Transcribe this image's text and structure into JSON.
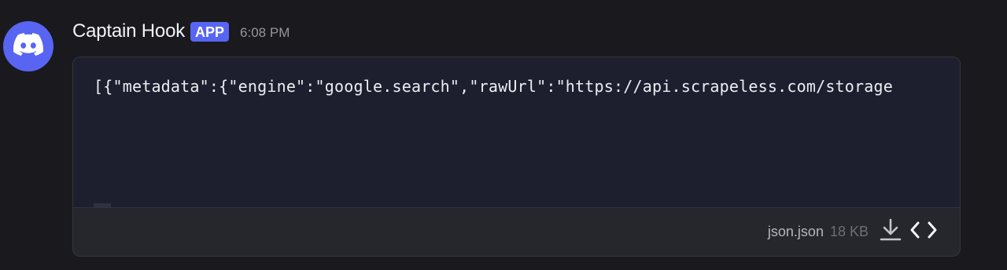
{
  "message": {
    "author": "Captain Hook",
    "badge": "APP",
    "timestamp": "6:08 PM",
    "avatar_icon": "discord-logo-icon"
  },
  "attachment": {
    "preview_text": "[{\"metadata\":{\"engine\":\"google.search\",\"rawUrl\":\"https://api.scrapeless.com/storage",
    "filename": "json.json",
    "filesize": "18 KB",
    "actions": {
      "download_icon": "download-icon",
      "view_code_icon": "code-icon"
    }
  },
  "colors": {
    "background": "#1a1a1e",
    "accent": "#5865f2",
    "code_background": "#1e1f2e"
  }
}
